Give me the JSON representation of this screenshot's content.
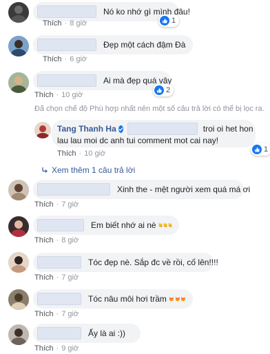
{
  "comments": [
    {
      "text": "Nó ko nhớ gì mình đâu!",
      "like": "Thích",
      "time": "8 giờ",
      "reaction_count": "1"
    },
    {
      "text": "Đẹp một cách đậm Đà",
      "like": "Thích",
      "time": "6 giờ"
    },
    {
      "text": "Ai mà đẹp quá vậy",
      "like": "Thích",
      "time": "10 giờ",
      "reaction_count": "2"
    },
    {
      "text": "Xinh the - mệt người xem quá má ơi",
      "like": "Thích",
      "time": "7 giờ"
    },
    {
      "text": "Em biết nhớ ai nè",
      "like": "Thích",
      "time": "8 giờ"
    },
    {
      "text": "Tóc đẹp nè. Sắp đc về rồi, cố lên!!!!",
      "like": "Thích",
      "time": "7 giờ"
    },
    {
      "text": "Tóc nâu môi hơi trầm",
      "like": "Thích",
      "time": "7 giờ"
    },
    {
      "text": "Ấy là ai :))",
      "like": "Thích",
      "time": "9 giờ"
    }
  ],
  "filter_notice": "Đã chọn chế độ Phù hợp nhất nên một số câu trả lời có thể bị lọc ra.",
  "reply": {
    "author": "Tang Thanh Ha",
    "text_line1": "troi oi het hon",
    "text_line2": "lau lau moi dc anh tui comment mot cai nay!",
    "like": "Thích",
    "time": "10 giờ",
    "reaction_count": "1"
  },
  "more_replies": "Xem thêm 1 câu trả lời",
  "colors": {
    "link": "#385898",
    "meta": "#90949c",
    "bubble": "#f2f3f5",
    "like": "#1877f2"
  }
}
